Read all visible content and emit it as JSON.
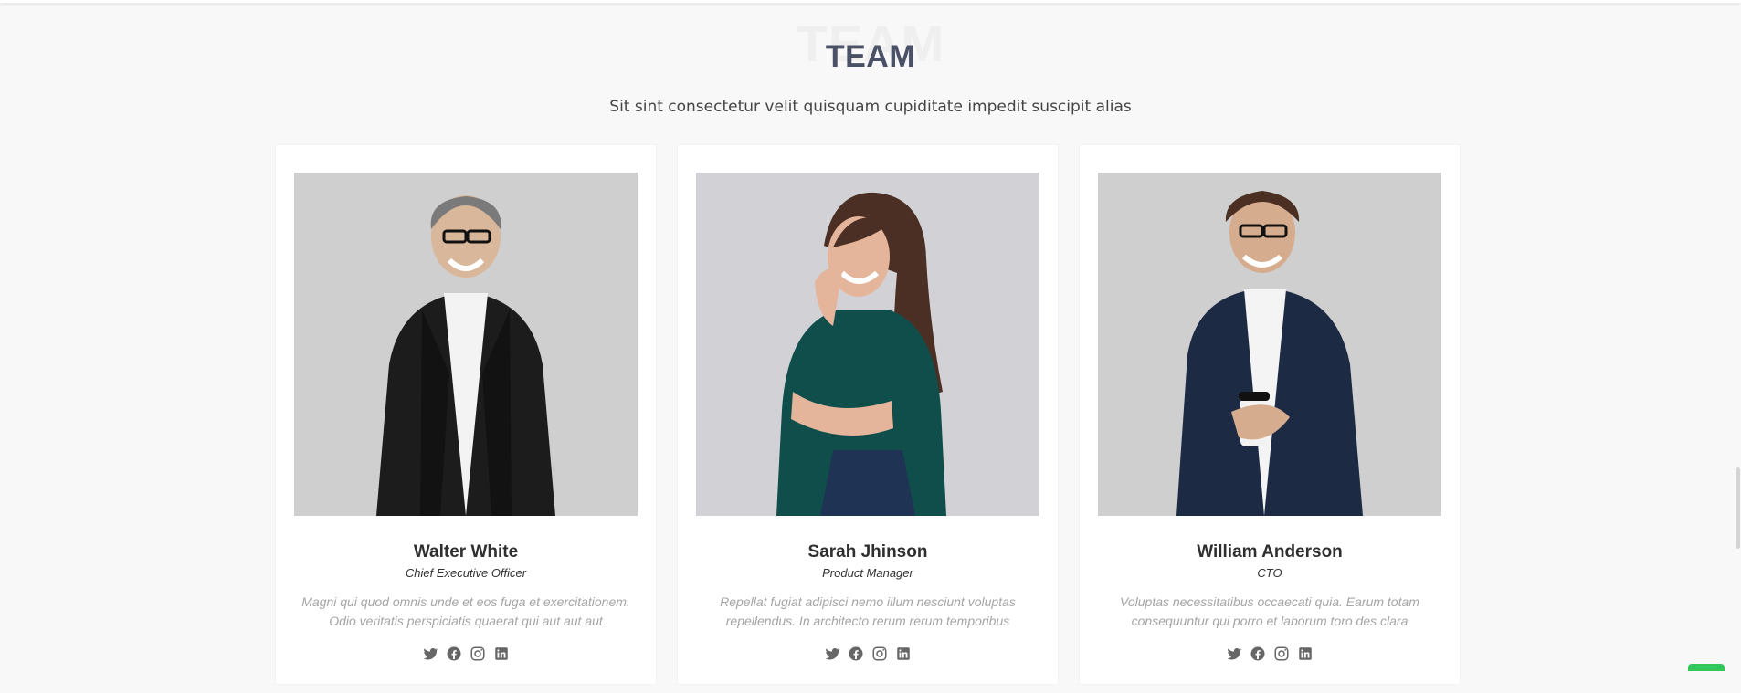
{
  "section": {
    "title_watermark": "TEAM",
    "title": "TEAM",
    "subtitle": "Sit sint consectetur velit quisquam cupiditate impedit suscipit alias"
  },
  "team": [
    {
      "name": "Walter White",
      "role": "Chief Executive Officer",
      "bio": "Magni qui quod omnis unde et eos fuga et exercitationem. Odio veritatis perspiciatis quaerat qui aut aut aut",
      "photo_icon": "portrait-photo",
      "social": [
        {
          "icon": "twitter-icon"
        },
        {
          "icon": "facebook-icon"
        },
        {
          "icon": "instagram-icon"
        },
        {
          "icon": "linkedin-icon"
        }
      ]
    },
    {
      "name": "Sarah Jhinson",
      "role": "Product Manager",
      "bio": "Repellat fugiat adipisci nemo illum nesciunt voluptas repellendus. In architecto rerum rerum temporibus",
      "photo_icon": "portrait-photo",
      "social": [
        {
          "icon": "twitter-icon"
        },
        {
          "icon": "facebook-icon"
        },
        {
          "icon": "instagram-icon"
        },
        {
          "icon": "linkedin-icon"
        }
      ]
    },
    {
      "name": "William Anderson",
      "role": "CTO",
      "bio": "Voluptas necessitatibus occaecati quia. Earum totam consequuntur qui porro et laborum toro des clara",
      "photo_icon": "portrait-photo",
      "social": [
        {
          "icon": "twitter-icon"
        },
        {
          "icon": "facebook-icon"
        },
        {
          "icon": "instagram-icon"
        },
        {
          "icon": "linkedin-icon"
        }
      ]
    }
  ],
  "colors": {
    "page_bg": "#f8f8f8",
    "title": "#4a5066",
    "watermark": "#efefef",
    "card_bg": "#ffffff",
    "icon": "#666666",
    "bio": "#a5a5a5"
  }
}
